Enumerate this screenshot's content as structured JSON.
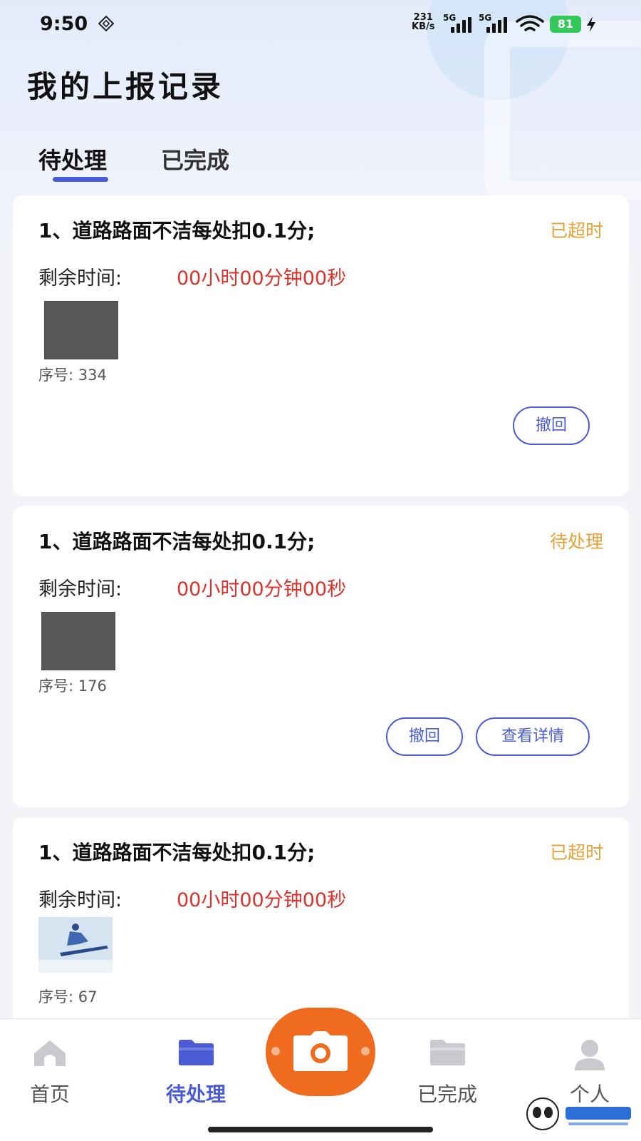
{
  "status_bar": {
    "time": "9:50",
    "net_speed_value": "231",
    "net_speed_unit": "KB/s",
    "signal_1": "5G",
    "signal_2": "5G",
    "battery": "81",
    "icons": [
      "nfc-icon",
      "signal-icon",
      "wifi-icon",
      "battery-icon",
      "charging-icon"
    ]
  },
  "header": {
    "title": "我的上报记录"
  },
  "tabs": [
    {
      "label": "待处理",
      "active": true
    },
    {
      "label": "已完成",
      "active": false
    }
  ],
  "cards": [
    {
      "title": "1、道路路面不洁每处扣0.1分;",
      "status": "已超时",
      "remaining_label": "剩余时间:",
      "remaining_value": "00小时00分钟00秒",
      "serial": "序号: 334",
      "buttons": [
        "撤回"
      ]
    },
    {
      "title": "1、道路路面不洁每处扣0.1分;",
      "status": "待处理",
      "remaining_label": "剩余时间:",
      "remaining_value": "00小时00分钟00秒",
      "serial": "序号: 176",
      "buttons": [
        "撤回",
        "查看详情"
      ]
    },
    {
      "title": "1、道路路面不洁每处扣0.1分;",
      "status": "已超时",
      "remaining_label": "剩余时间:",
      "remaining_value": "00小时00分钟00秒",
      "serial": "序号: 67",
      "buttons": []
    }
  ],
  "bottom_nav": {
    "items": [
      {
        "label": "首页",
        "icon": "home-icon",
        "active": false
      },
      {
        "label": "待处理",
        "icon": "folder-icon",
        "active": true
      },
      {
        "label": "已完成",
        "icon": "folder-icon",
        "active": false
      },
      {
        "label": "个人",
        "icon": "user-icon",
        "active": false
      }
    ],
    "center_icon": "camera-icon"
  },
  "colors": {
    "accent": "#4a5bd4",
    "status_warning": "#e3a23a",
    "countdown": "#d9332b",
    "camera_button": "#ef6c1f"
  }
}
